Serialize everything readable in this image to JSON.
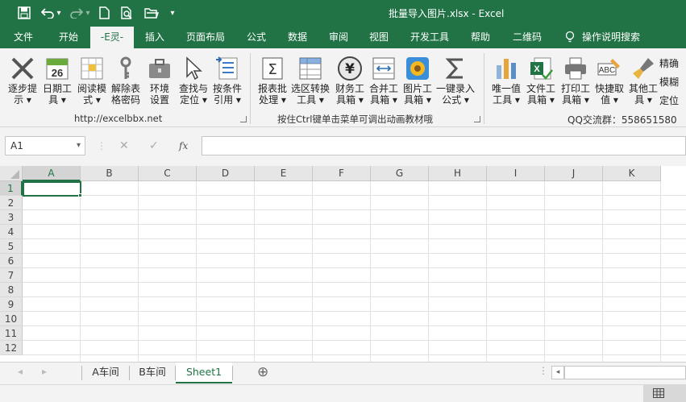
{
  "window": {
    "title": "批量导入图片.xlsx  -  Excel"
  },
  "quick_access": [
    {
      "name": "save-icon",
      "glyph": "💾"
    },
    {
      "name": "undo-icon",
      "glyph": "↶"
    },
    {
      "name": "undo-dropdown-icon",
      "glyph": "▾"
    },
    {
      "name": "redo-icon",
      "glyph": "↷"
    },
    {
      "name": "redo-dropdown-icon",
      "glyph": "▾"
    },
    {
      "name": "new-file-icon",
      "glyph": "🗋"
    },
    {
      "name": "print-preview-icon",
      "glyph": "🔍"
    },
    {
      "name": "open-folder-icon",
      "glyph": "📂"
    },
    {
      "name": "customize-qat-icon",
      "glyph": "▾"
    }
  ],
  "tabs": [
    "文件",
    "开始",
    "-E灵-",
    "插入",
    "页面布局",
    "公式",
    "数据",
    "审阅",
    "视图",
    "开发工具",
    "帮助",
    "二维码"
  ],
  "active_tab": "-E灵-",
  "tell_me": {
    "icon": "lightbulb-icon",
    "label": "操作说明搜索"
  },
  "ribbon": {
    "group1": {
      "buttons": [
        {
          "icon": "step-tip-icon",
          "label": "逐步提\n示 ▾"
        },
        {
          "icon": "calendar-icon",
          "label": "日期工\n具 ▾"
        },
        {
          "icon": "reading-mode-icon",
          "label": "阅读模\n式 ▾"
        },
        {
          "icon": "key-icon",
          "label": "解除表\n格密码"
        },
        {
          "icon": "toolbox-icon",
          "label": "环境\n设置"
        },
        {
          "icon": "cursor-icon",
          "label": "查找与\n定位 ▾"
        },
        {
          "icon": "conditional-ref-icon",
          "label": "按条件\n引用 ▾"
        }
      ],
      "footer": "http://excelbbx.net"
    },
    "group2": {
      "buttons": [
        {
          "icon": "sum-report-icon",
          "label": "报表批\n处理 ▾"
        },
        {
          "icon": "range-convert-icon",
          "label": "选区转换\n工具 ▾"
        },
        {
          "icon": "finance-icon",
          "label": "财务工\n具箱 ▾"
        },
        {
          "icon": "merge-icon",
          "label": "合并工\n具箱 ▾"
        },
        {
          "icon": "picture-icon",
          "label": "图片工\n具箱 ▾"
        },
        {
          "icon": "sigma-icon",
          "label": "一键录入\n公式 ▾"
        }
      ],
      "footer": "按住Ctrl键单击菜单可调出动画教材哦"
    },
    "group3": {
      "buttons": [
        {
          "icon": "unique-value-icon",
          "label": "唯一值\n工具 ▾"
        },
        {
          "icon": "file-tool-icon",
          "label": "文件工\n具箱 ▾"
        },
        {
          "icon": "print-icon",
          "label": "打印工\n具箱 ▾"
        },
        {
          "icon": "quick-pick-icon",
          "label": "快捷取\n值 ▾"
        },
        {
          "icon": "brush-icon",
          "label": "其他工\n具 ▾"
        }
      ],
      "side_labels": [
        "精确",
        "模糊",
        "定位"
      ],
      "footer": "QQ交流群：558651580"
    }
  },
  "formula_bar": {
    "name_box": "A1",
    "name_box_arrow": "▾",
    "cancel": "✕",
    "enter": "✓",
    "fx": "fx",
    "value": ""
  },
  "columns": [
    "A",
    "B",
    "C",
    "D",
    "E",
    "F",
    "G",
    "H",
    "I",
    "J",
    "K"
  ],
  "rows": [
    "1",
    "2",
    "3",
    "4",
    "5",
    "6",
    "7",
    "8",
    "9",
    "10",
    "11",
    "12"
  ],
  "selected_cell": "A1",
  "sheets": [
    "A车间",
    "B车间",
    "Sheet1"
  ],
  "active_sheet": "Sheet1",
  "sheet_nav": {
    "prev": "◂",
    "next": "▸",
    "add": "⊕"
  },
  "colors": {
    "accent": "#217346",
    "ribbon_bg": "#f3f3f3"
  }
}
